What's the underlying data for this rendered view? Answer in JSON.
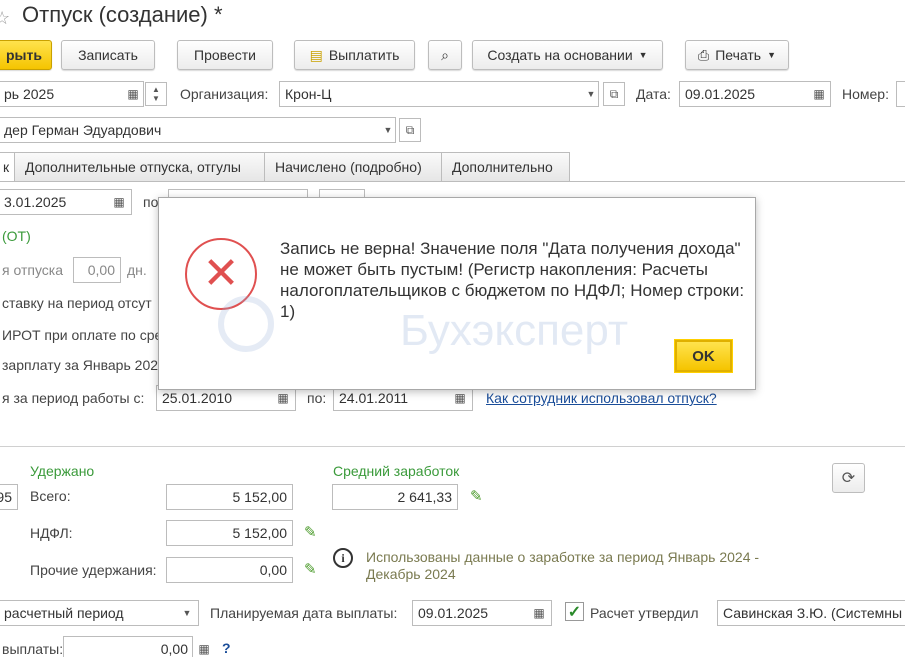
{
  "window": {
    "title": "Отпуск (создание) *"
  },
  "toolbar": {
    "close_label": "рыть",
    "save_label": "Записать",
    "post_label": "Провести",
    "pay_label": "Выплатить",
    "create_based_label": "Создать на основании",
    "print_label": "Печать"
  },
  "header": {
    "month_value": "рь 2025",
    "org_label": "Организация:",
    "org_value": "Крон-Ц",
    "date_label": "Дата:",
    "date_value": "09.01.2025",
    "number_label": "Номер:",
    "employee_value": "дер Герман Эдуардович"
  },
  "tabs": [
    {
      "label": "к"
    },
    {
      "label": "Дополнительные отпуска, отгулы"
    },
    {
      "label": "Начислено (подробно)"
    },
    {
      "label": "Дополнительно"
    }
  ],
  "main": {
    "from_value": "3.01.2025",
    "to_label": "по",
    "vacation_type": "(ОТ)",
    "days_label": "я отпуска",
    "days_value": "0,00",
    "days_unit": "дн.",
    "rate_label": "ставку на период отсут",
    "mrot_label": "ИРОТ при оплате по сре",
    "salary_label": "зарплату за Январь 202",
    "period_label": "я за период работы с:",
    "period_from": "25.01.2010",
    "period_to_label": "по:",
    "period_to": "24.01.2011",
    "used_link": "Как сотрудник использовал отпуск?"
  },
  "totals": {
    "left_value": "95",
    "withheld_title": "Удержано",
    "total_label": "Всего:",
    "total_value": "5 152,00",
    "ndfl_label": "НДФЛ:",
    "ndfl_value": "5 152,00",
    "other_label": "Прочие удержания:",
    "other_value": "0,00",
    "avg_title": "Средний заработок",
    "avg_value": "2 641,33",
    "info_text": "Использованы данные о заработке за период Январь 2024 - Декабрь 2024"
  },
  "footer": {
    "period_value": "расчетный период",
    "planned_label": "Планируемая дата выплаты:",
    "planned_value": "09.01.2025",
    "approved_label": "Расчет утвердил",
    "approver_value": "Савинская З.Ю. (Системны",
    "payout_label": "выплаты:",
    "payout_value": "0,00",
    "help": "?"
  },
  "dialog": {
    "message": "Запись не верна! Значение поля \"Дата получения дохода\" не может быть пустым! (Регистр накопления: Расчеты налогоплательщиков с бюджетом по НДФЛ; Номер строки: 1)",
    "ok_label": "OK"
  },
  "watermark": {
    "text": "Бухэксперт"
  },
  "colors": {
    "accent": "#f5c400",
    "error": "#e05050",
    "green": "#3a9a3a",
    "link": "#1a4d99"
  }
}
